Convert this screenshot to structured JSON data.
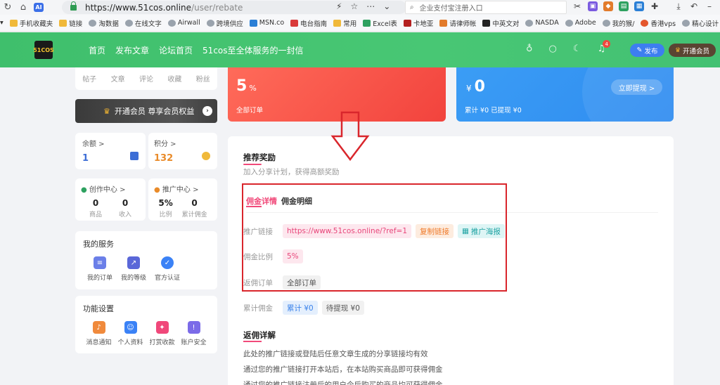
{
  "browser": {
    "url_host": "https://www.51cos.online",
    "url_path": "/user/rebate",
    "ai_label": "AI",
    "search_text": "企业支付宝注册入口",
    "bookmarks": [
      "手机收藏夹",
      "链接",
      "淘数据",
      "在线文字",
      "Airwall",
      "跨境供应",
      "MSN.co",
      "电台指南",
      "常用",
      "Excel表",
      "卡地亚",
      "请律师帐",
      "中英文对",
      "NASDA",
      "Adobe",
      "我的猴/",
      "香港vps",
      "精心设计"
    ]
  },
  "header": {
    "logo": "51COS",
    "nav": [
      "首页",
      "发布文章",
      "论坛首页",
      "51cos至全体服务的一封信"
    ],
    "notif_count": "4",
    "publish_label": "发布",
    "vip_label": "开通会员"
  },
  "sidebar": {
    "stats": [
      "帖子",
      "文章",
      "评论",
      "收藏",
      "粉丝"
    ],
    "vip_banner": "开通会员 尊享会员权益",
    "balance_label": "余额 >",
    "balance_value": "1",
    "points_label": "积分 >",
    "points_value": "132",
    "creator": {
      "title": "创作中心 >",
      "c1_num": "0",
      "c1_sub": "商品",
      "c2_num": "0",
      "c2_sub": "收入"
    },
    "promo": {
      "title": "推广中心 >",
      "c1_num": "5%",
      "c1_sub": "比例",
      "c2_num": "0",
      "c2_sub": "累计佣金"
    },
    "services": {
      "title": "我的服务",
      "items": [
        "我的订单",
        "我的等级",
        "官方认证"
      ]
    },
    "functions": {
      "title": "功能设置",
      "items": [
        "消息通知",
        "个人资料",
        "打赏收款",
        "账户安全"
      ]
    }
  },
  "summary": {
    "red_value": "5",
    "red_unit": "%",
    "red_caption": "全部订单",
    "blue_currency": "¥",
    "blue_value": "0",
    "blue_caption": "累计 ¥0   已提现 ¥0",
    "withdraw_label": "立即提现 >"
  },
  "main": {
    "title": "推荐奖励",
    "subtitle": "加入分享计划，获得高额奖励",
    "tabs": [
      "佣金详情",
      "佣金明细"
    ],
    "rows": {
      "link_label": "推广链接",
      "link_value": "https://www.51cos.online/?ref=1",
      "copy_label": "复制链接",
      "poster_label": "推广海报",
      "ratio_label": "佣金比例",
      "ratio_value": "5%",
      "orders_label": "返佣订单",
      "orders_value": "全部订单",
      "total_label": "累计佣金",
      "total_value": "累计 ¥0",
      "pending_value": "待提现 ¥0"
    },
    "detail_title": "返佣详解",
    "paragraphs": [
      "此处的推广链接或登陆后任意文章生成的分享链接均有效",
      "通过您的推广链接打开本站后，在本站购买商品即可获得佣金",
      "通过您的推广链接注册后的用户今后购买的商品均可获得佣金"
    ]
  },
  "colors": {
    "accent": "#f14a7a",
    "header_green": "#48c774",
    "annotation_red": "#d9262c"
  }
}
